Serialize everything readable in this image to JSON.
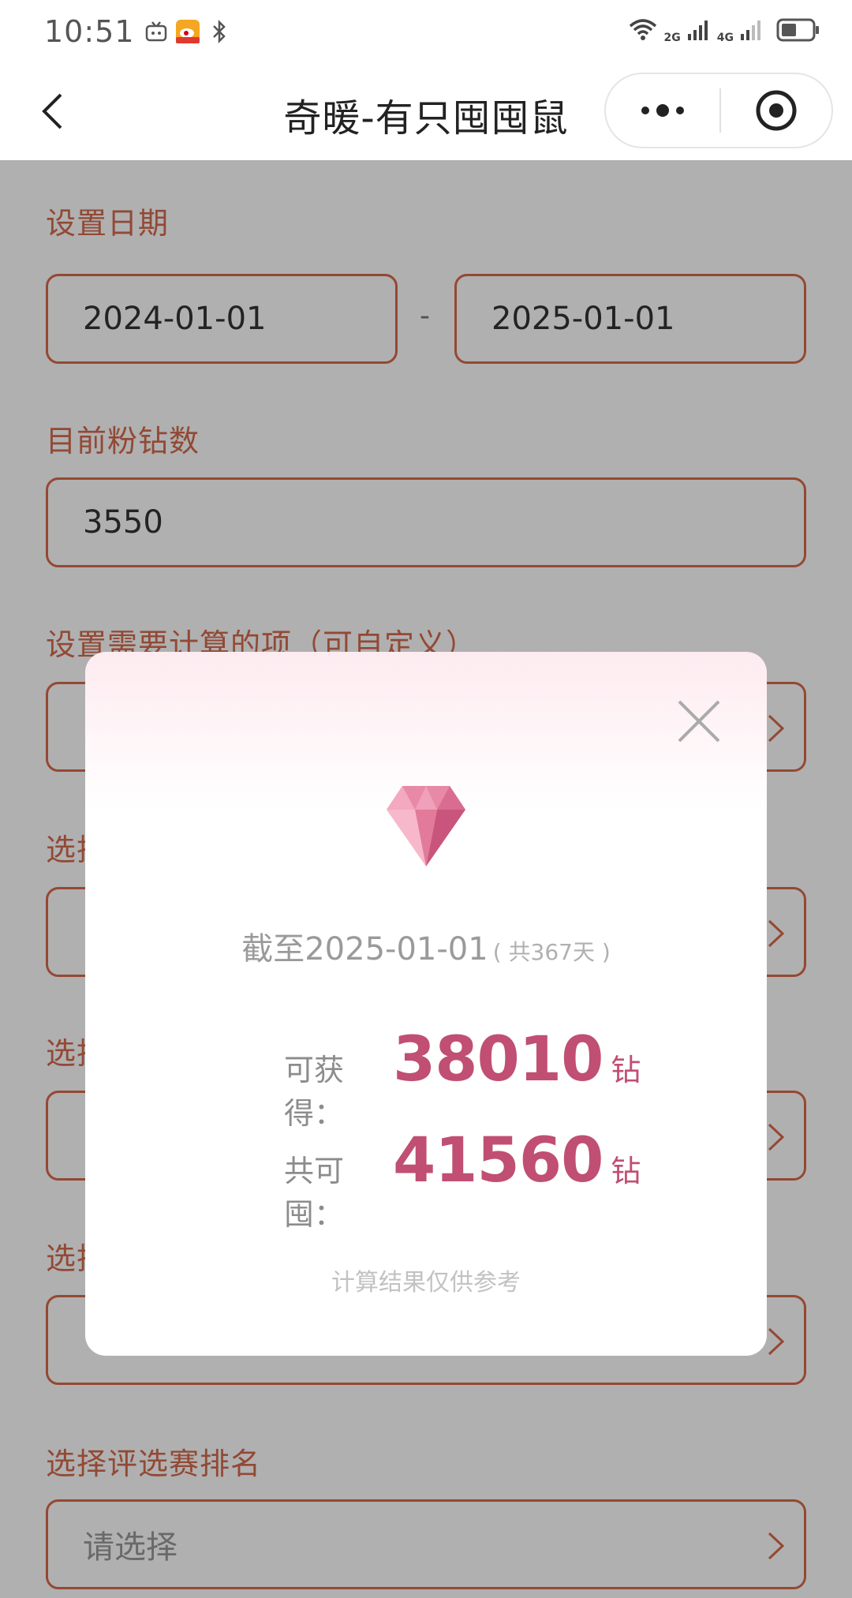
{
  "status_bar": {
    "time": "10:51",
    "network_labels": [
      "2G",
      "4G"
    ]
  },
  "nav": {
    "title": "奇暖-有只囤囤鼠"
  },
  "form": {
    "date_section_label": "设置日期",
    "start_date": "2024-01-01",
    "date_separator": "-",
    "end_date": "2025-01-01",
    "diamond_section_label": "目前粉钻数",
    "diamond_count": "3550",
    "items_section_label": "设置需要计算的项（可自定义）",
    "select_section_label_partial": "选择",
    "ranking_section_label": "选择评选赛排名",
    "ranking_placeholder": "请选择"
  },
  "modal": {
    "deadline_prefix": "截至",
    "deadline_date": "2025-01-01",
    "deadline_days": "( 共367天 )",
    "obtainable_label": "可获得：",
    "obtainable_value": "38010",
    "total_label": "共可囤：",
    "total_value": "41560",
    "unit": "钻",
    "disclaimer": "计算结果仅供参考"
  },
  "colors": {
    "accent": "#d8694a",
    "value_pink": "#c04f73",
    "diamond_pink": "#e27a9a"
  }
}
